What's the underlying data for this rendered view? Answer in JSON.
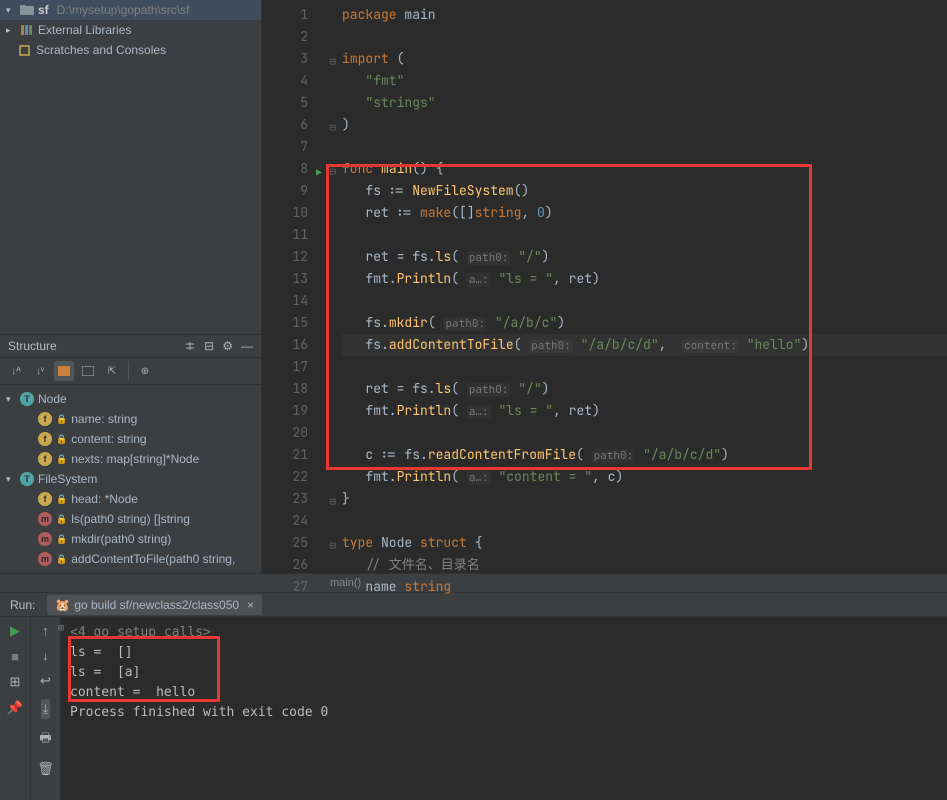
{
  "project": {
    "root_chev": "▾",
    "root_name": "sf",
    "root_path": "D:\\mysetup\\gopath\\src\\sf",
    "external_libs": "External Libraries",
    "scratches": "Scratches and Consoles"
  },
  "structure": {
    "title": "Structure",
    "items": [
      {
        "chev": "▾",
        "badge": "T",
        "name": "Node",
        "kind": "t"
      },
      {
        "badge": "f",
        "lock": true,
        "name": "name: string",
        "kind": "f",
        "indent": 1
      },
      {
        "badge": "f",
        "lock": true,
        "name": "content: string",
        "kind": "f",
        "indent": 1
      },
      {
        "badge": "f",
        "lock": true,
        "name": "nexts: map[string]*Node",
        "kind": "f",
        "indent": 1
      },
      {
        "chev": "▾",
        "badge": "T",
        "name": "FileSystem",
        "kind": "t"
      },
      {
        "badge": "f",
        "lock": true,
        "name": "head: *Node",
        "kind": "f",
        "indent": 1
      },
      {
        "badge": "m",
        "lock": true,
        "name": "ls(path0 string) []string",
        "kind": "m",
        "indent": 1
      },
      {
        "badge": "m",
        "lock": true,
        "name": "mkdir(path0 string)",
        "kind": "m",
        "indent": 1
      },
      {
        "badge": "m",
        "lock": true,
        "name": "addContentToFile(path0 string,",
        "kind": "m",
        "indent": 1
      }
    ]
  },
  "code": {
    "lines": [
      {
        "n": 1,
        "tokens": [
          [
            "kw",
            "package"
          ],
          [
            "id",
            " main"
          ]
        ]
      },
      {
        "n": 2,
        "tokens": []
      },
      {
        "n": 3,
        "fold": "⊟",
        "tokens": [
          [
            "kw",
            "import"
          ],
          [
            "id",
            " ("
          ]
        ]
      },
      {
        "n": 4,
        "tokens": [
          [
            "id",
            "   "
          ],
          [
            "str",
            "\"fmt\""
          ]
        ]
      },
      {
        "n": 5,
        "tokens": [
          [
            "id",
            "   "
          ],
          [
            "str",
            "\"strings\""
          ]
        ]
      },
      {
        "n": 6,
        "fold": "⊟",
        "tokens": [
          [
            "id",
            ")"
          ]
        ]
      },
      {
        "n": 7,
        "tokens": []
      },
      {
        "n": 8,
        "run": true,
        "fold": "⊟",
        "tokens": [
          [
            "kw",
            "func"
          ],
          [
            "id",
            " "
          ],
          [
            "fn",
            "main"
          ],
          [
            "id",
            "() {"
          ]
        ]
      },
      {
        "n": 9,
        "tokens": [
          [
            "id",
            "   fs := "
          ],
          [
            "fn",
            "NewFileSystem"
          ],
          [
            "id",
            "()"
          ]
        ]
      },
      {
        "n": 10,
        "tokens": [
          [
            "id",
            "   ret := "
          ],
          [
            "builtin",
            "make"
          ],
          [
            "id",
            "([]"
          ],
          [
            "kw",
            "string"
          ],
          [
            "id",
            ", "
          ],
          [
            "num",
            "0"
          ],
          [
            "id",
            ")"
          ]
        ]
      },
      {
        "n": 11,
        "tokens": []
      },
      {
        "n": 12,
        "tokens": [
          [
            "id",
            "   ret = fs."
          ],
          [
            "fn",
            "ls"
          ],
          [
            "id",
            "( "
          ],
          [
            "hint",
            "path0:"
          ],
          [
            "id",
            " "
          ],
          [
            "str",
            "\"/\""
          ],
          [
            "id",
            ")"
          ]
        ]
      },
      {
        "n": 13,
        "tokens": [
          [
            "id",
            "   fmt."
          ],
          [
            "fn",
            "Println"
          ],
          [
            "id",
            "( "
          ],
          [
            "hint",
            "a…:"
          ],
          [
            "id",
            " "
          ],
          [
            "str",
            "\"ls = \""
          ],
          [
            "id",
            ", ret)"
          ]
        ]
      },
      {
        "n": 14,
        "tokens": []
      },
      {
        "n": 15,
        "tokens": [
          [
            "id",
            "   fs."
          ],
          [
            "fn",
            "mkdir"
          ],
          [
            "id",
            "( "
          ],
          [
            "hint",
            "path0:"
          ],
          [
            "id",
            " "
          ],
          [
            "str",
            "\"/a/b/c\""
          ],
          [
            "id",
            ")"
          ]
        ]
      },
      {
        "n": 16,
        "caret": true,
        "tokens": [
          [
            "id",
            "   fs."
          ],
          [
            "fn",
            "addContentToFile"
          ],
          [
            "id",
            "( "
          ],
          [
            "hint",
            "path0:"
          ],
          [
            "id",
            " "
          ],
          [
            "str",
            "\"/a/b/c/d\""
          ],
          [
            "id",
            ",  "
          ],
          [
            "hint",
            "content:"
          ],
          [
            "id",
            " "
          ],
          [
            "str",
            "\"hello\""
          ],
          [
            "id",
            ")"
          ]
        ]
      },
      {
        "n": 17,
        "tokens": []
      },
      {
        "n": 18,
        "tokens": [
          [
            "id",
            "   ret = fs."
          ],
          [
            "fn",
            "ls"
          ],
          [
            "id",
            "( "
          ],
          [
            "hint",
            "path0:"
          ],
          [
            "id",
            " "
          ],
          [
            "str",
            "\"/\""
          ],
          [
            "id",
            ")"
          ]
        ]
      },
      {
        "n": 19,
        "tokens": [
          [
            "id",
            "   fmt."
          ],
          [
            "fn",
            "Println"
          ],
          [
            "id",
            "( "
          ],
          [
            "hint",
            "a…:"
          ],
          [
            "id",
            " "
          ],
          [
            "str",
            "\"ls = \""
          ],
          [
            "id",
            ", ret)"
          ]
        ]
      },
      {
        "n": 20,
        "tokens": []
      },
      {
        "n": 21,
        "tokens": [
          [
            "id",
            "   c := fs."
          ],
          [
            "fn",
            "readContentFromFile"
          ],
          [
            "id",
            "( "
          ],
          [
            "hint",
            "path0:"
          ],
          [
            "id",
            " "
          ],
          [
            "str",
            "\"/a/b/c/d\""
          ],
          [
            "id",
            ")"
          ]
        ]
      },
      {
        "n": 22,
        "tokens": [
          [
            "id",
            "   fmt."
          ],
          [
            "fn",
            "Println"
          ],
          [
            "id",
            "( "
          ],
          [
            "hint",
            "a…:"
          ],
          [
            "id",
            " "
          ],
          [
            "str",
            "\"content = \""
          ],
          [
            "id",
            ", c)"
          ]
        ]
      },
      {
        "n": 23,
        "fold": "⊟",
        "tokens": [
          [
            "id",
            "}"
          ]
        ]
      },
      {
        "n": 24,
        "tokens": []
      },
      {
        "n": 25,
        "fold": "⊟",
        "tokens": [
          [
            "kw",
            "type"
          ],
          [
            "id",
            " Node "
          ],
          [
            "kw",
            "struct"
          ],
          [
            "id",
            " {"
          ]
        ]
      },
      {
        "n": 26,
        "tokens": [
          [
            "id",
            "   "
          ],
          [
            "cm",
            "// 文件名、目录名"
          ]
        ]
      },
      {
        "n": 27,
        "tokens": [
          [
            "id",
            "   name "
          ],
          [
            "kw",
            "string"
          ]
        ]
      }
    ],
    "breadcrumb": "main()"
  },
  "run": {
    "label": "Run:",
    "tab": "go build sf/newclass2/class050",
    "lines": [
      {
        "cls": "dim",
        "text": "<4 go setup calls>"
      },
      {
        "text": "ls =  []"
      },
      {
        "text": "ls =  [a]"
      },
      {
        "text": "content =  hello"
      },
      {
        "text": ""
      },
      {
        "text": "Process finished with exit code 0"
      }
    ]
  }
}
